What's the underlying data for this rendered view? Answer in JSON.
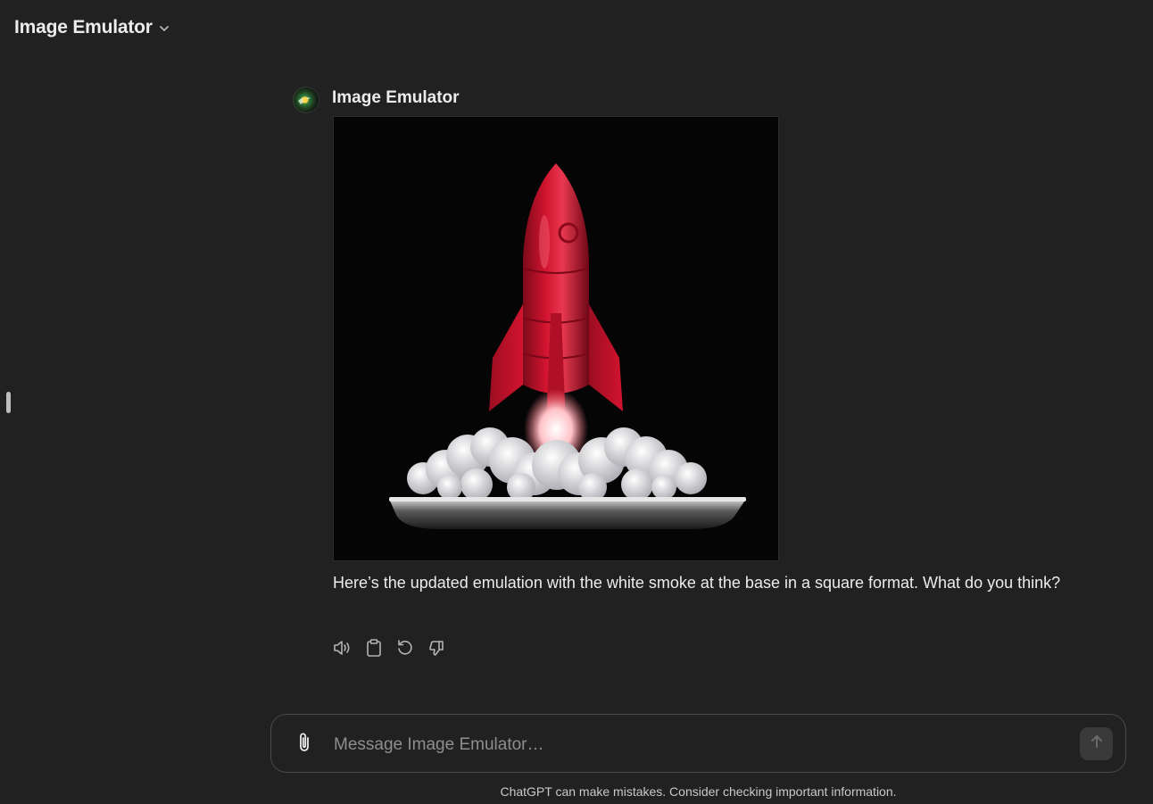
{
  "header": {
    "title": "Image Emulator",
    "dropdown_icon": "chevron-down-icon"
  },
  "message": {
    "author": "Image Emulator",
    "avatar_icon": "gpt-avatar",
    "image_icon": "rocket-launch-image",
    "text": "Here’s the updated emulation with the white smoke at the base in a square format. What do you think?",
    "actions": [
      {
        "icon": "speaker-icon",
        "label": "Read aloud"
      },
      {
        "icon": "clipboard-icon",
        "label": "Copy"
      },
      {
        "icon": "regenerate-icon",
        "label": "Regenerate"
      },
      {
        "icon": "thumbs-down-icon",
        "label": "Bad response"
      }
    ]
  },
  "composer": {
    "placeholder": "Message Image Emulator…",
    "value": "",
    "attach_icon": "paperclip-icon",
    "send_icon": "arrow-up-icon"
  },
  "footer": {
    "disclaimer": "ChatGPT can make mistakes. Consider checking important information."
  },
  "colors": {
    "background": "#212121",
    "text": "#ececec",
    "muted": "#8e8e8e",
    "border": "#4a4a4a",
    "rocket_red": "#c8102e"
  }
}
